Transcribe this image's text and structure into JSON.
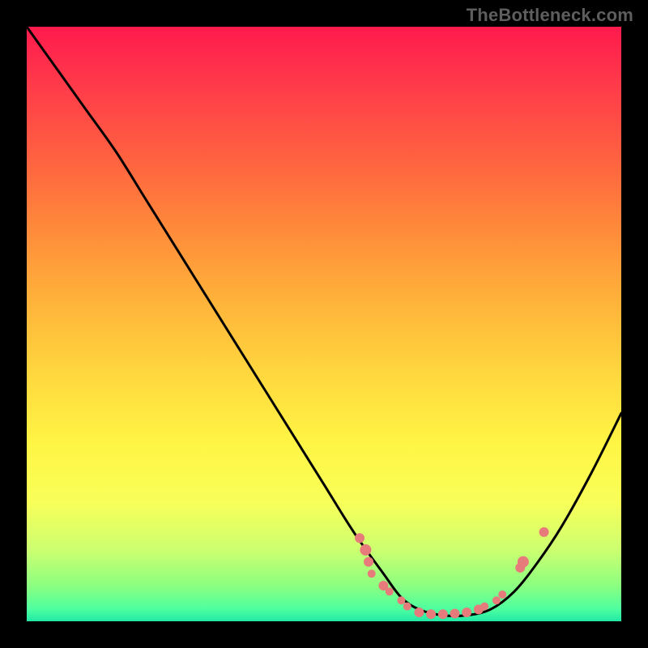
{
  "watermark": "TheBottleneck.com",
  "colors": {
    "frame": "#000000",
    "curve": "#000000",
    "marker": "#e77a7a",
    "gradient_top": "#ff1a4d",
    "gradient_bottom": "#20e8a5"
  },
  "chart_data": {
    "type": "line",
    "title": "",
    "xlabel": "",
    "ylabel": "",
    "xlim": [
      0,
      100
    ],
    "ylim": [
      0,
      100
    ],
    "series": [
      {
        "name": "bottleneck-curve",
        "x": [
          0,
          5,
          10,
          15,
          20,
          25,
          30,
          35,
          40,
          45,
          50,
          55,
          60,
          63,
          66,
          70,
          74,
          78,
          82,
          86,
          90,
          95,
          100
        ],
        "y": [
          100,
          93,
          86,
          79,
          71,
          63,
          55,
          47,
          39,
          31,
          23,
          15,
          8,
          4,
          2,
          1,
          1,
          2,
          5,
          10,
          16,
          25,
          35
        ]
      }
    ],
    "markers": [
      {
        "x": 56,
        "y": 14,
        "r": 6
      },
      {
        "x": 57,
        "y": 12,
        "r": 7
      },
      {
        "x": 57.5,
        "y": 10,
        "r": 6
      },
      {
        "x": 58,
        "y": 8,
        "r": 5
      },
      {
        "x": 60,
        "y": 6,
        "r": 6
      },
      {
        "x": 61,
        "y": 5,
        "r": 5
      },
      {
        "x": 63,
        "y": 3.5,
        "r": 5
      },
      {
        "x": 64,
        "y": 2.5,
        "r": 5
      },
      {
        "x": 66,
        "y": 1.5,
        "r": 6
      },
      {
        "x": 68,
        "y": 1.2,
        "r": 6
      },
      {
        "x": 70,
        "y": 1.2,
        "r": 6
      },
      {
        "x": 72,
        "y": 1.3,
        "r": 6
      },
      {
        "x": 74,
        "y": 1.5,
        "r": 6
      },
      {
        "x": 76,
        "y": 2.0,
        "r": 6
      },
      {
        "x": 77,
        "y": 2.5,
        "r": 5
      },
      {
        "x": 79,
        "y": 3.5,
        "r": 5
      },
      {
        "x": 80,
        "y": 4.5,
        "r": 5
      },
      {
        "x": 83,
        "y": 9,
        "r": 6
      },
      {
        "x": 83.5,
        "y": 10,
        "r": 7
      },
      {
        "x": 87,
        "y": 15,
        "r": 6
      }
    ]
  }
}
